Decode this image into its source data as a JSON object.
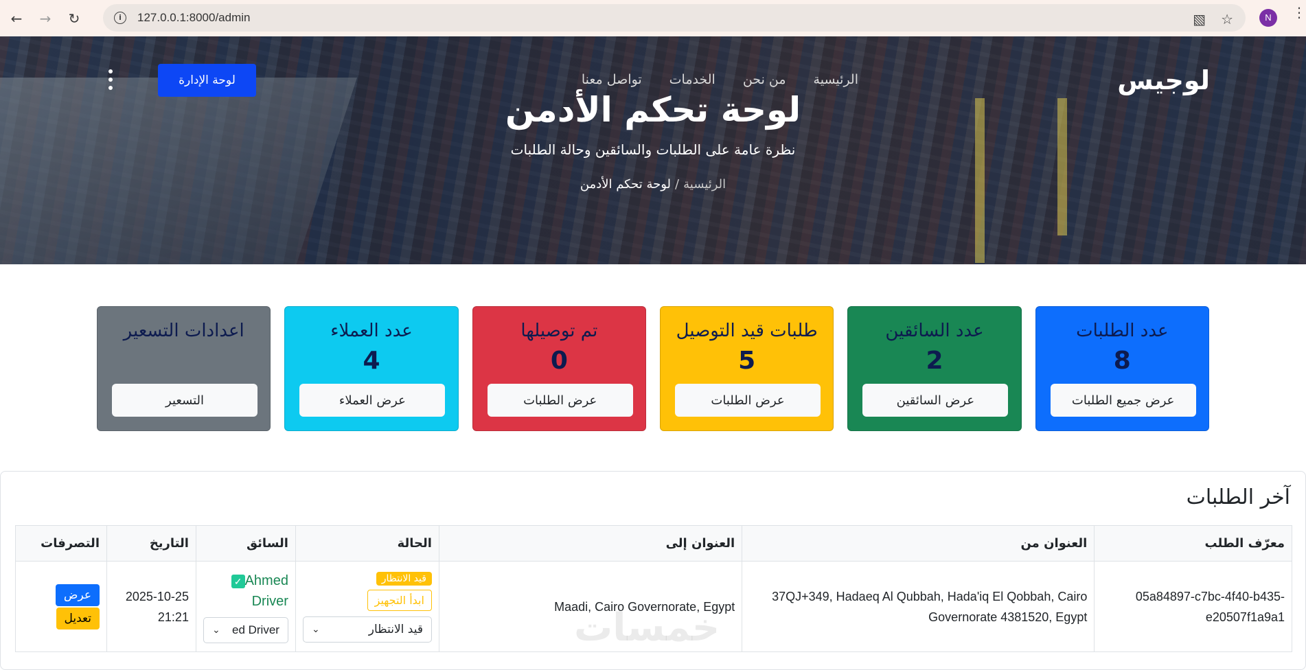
{
  "browser": {
    "url": "127.0.0.1:8000/admin",
    "profile_initial": "N"
  },
  "brand": "لوجيس",
  "nav": [
    "الرئيسية",
    "من نحن",
    "الخدمات",
    "تواصل معنا"
  ],
  "admin_button": "لوحة الإدارة",
  "hero": {
    "title": "لوحة تحكم الأدمن",
    "subtitle": "نظرة عامة على الطلبات والسائقين وحالة الطلبات",
    "breadcrumb_home": "الرئيسية",
    "breadcrumb_sep": "/",
    "breadcrumb_current": "لوحة تحكم الأدمن"
  },
  "cards": [
    {
      "title": "عدد الطلبات",
      "value": "8",
      "button": "عرض جميع الطلبات",
      "color": "#0d6efd"
    },
    {
      "title": "عدد السائقين",
      "value": "2",
      "button": "عرض السائقين",
      "color": "#198754"
    },
    {
      "title": "طلبات قيد التوصيل",
      "value": "5",
      "button": "عرض الطلبات",
      "color": "#ffc107"
    },
    {
      "title": "تم توصيلها",
      "value": "0",
      "button": "عرض الطلبات",
      "color": "#dc3545"
    },
    {
      "title": "عدد العملاء",
      "value": "4",
      "button": "عرض العملاء",
      "color": "#0dcaf0"
    },
    {
      "title": "اعدادات التسعير",
      "value": "",
      "button": "التسعير",
      "color": "#6c757d"
    }
  ],
  "orders": {
    "title": "آخر الطلبات",
    "headers": [
      "معرّف الطلب",
      "العنوان من",
      "العنوان إلى",
      "الحالة",
      "السائق",
      "التاريخ",
      "التصرفات"
    ],
    "row": {
      "id": "05a84897-c7bc-4f40-b435-e20507f1a9a1",
      "from": "37QJ+349, Hadaeq Al Qubbah, Hada'iq El Qobbah, Cairo Governorate 4381520, Egypt",
      "to": "Maadi, Cairo Governorate, Egypt",
      "status_badge": "قيد الانتظار",
      "status_action": "ابدأ التجهيز",
      "status_select": "قيد الانتظار",
      "driver_name": "Ahmed Driver",
      "driver_select": "ed Driver",
      "date": "2025-10-25 21:21",
      "view_label": "عرض",
      "edit_label": "تعديل"
    }
  },
  "watermark": "خمسات"
}
